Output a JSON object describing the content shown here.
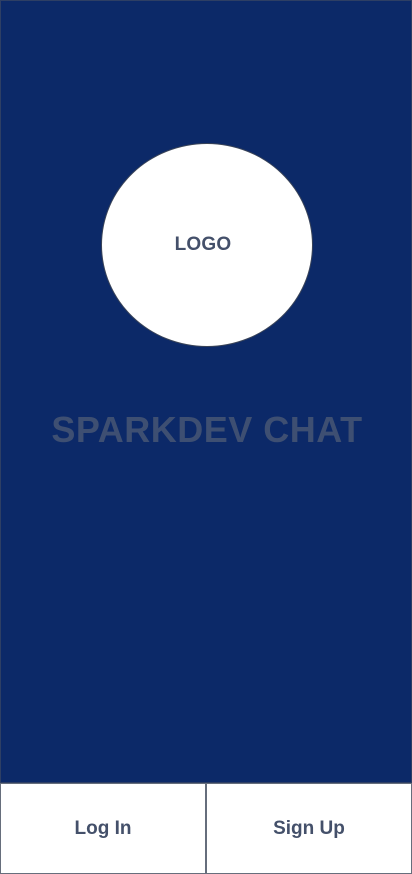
{
  "logo": {
    "label": "LOGO"
  },
  "app": {
    "title": "SPARKDEV CHAT"
  },
  "actions": {
    "login_label": "Log In",
    "signup_label": "Sign Up"
  },
  "colors": {
    "background": "#0c2968",
    "title_text": "#3e4f72",
    "button_text": "#44506a"
  }
}
